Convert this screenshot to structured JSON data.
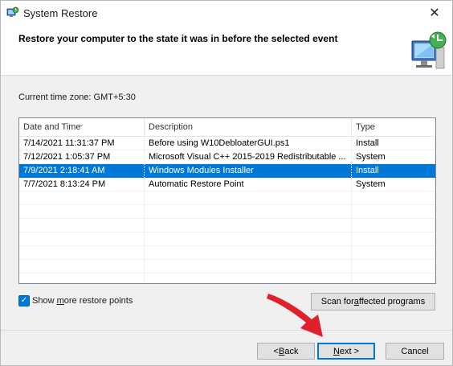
{
  "window": {
    "title": "System Restore",
    "close_glyph": "✕"
  },
  "header": {
    "text": "Restore your computer to the state it was in before the selected event"
  },
  "timezone": "Current time zone: GMT+5:30",
  "table": {
    "columns": [
      "Date and Time",
      "Description",
      "Type"
    ],
    "rows": [
      {
        "date": "7/14/2021 11:31:37 PM",
        "description": "Before using W10DebloaterGUI.ps1",
        "type": "Install",
        "selected": false
      },
      {
        "date": "7/12/2021 1:05:37 PM",
        "description": "Microsoft Visual C++ 2015-2019 Redistributable ...",
        "type": "System",
        "selected": false
      },
      {
        "date": "7/9/2021 2:18:41 AM",
        "description": "Windows Modules Installer",
        "type": "Install",
        "selected": true
      },
      {
        "date": "7/7/2021 8:13:24 PM",
        "description": "Automatic Restore Point",
        "type": "System",
        "selected": false
      }
    ]
  },
  "show_more": {
    "label_prefix": "Show ",
    "label_accel": "m",
    "label_suffix": "ore restore points",
    "checked": true
  },
  "buttons": {
    "scan_prefix": "Scan for ",
    "scan_accel": "a",
    "scan_suffix": "ffected programs",
    "back_prefix": "< ",
    "back_accel": "B",
    "back_suffix": "ack",
    "next_accel": "N",
    "next_suffix": "ext >",
    "cancel": "Cancel"
  },
  "colors": {
    "selection": "#0078d7",
    "arrow": "#e0202a"
  }
}
